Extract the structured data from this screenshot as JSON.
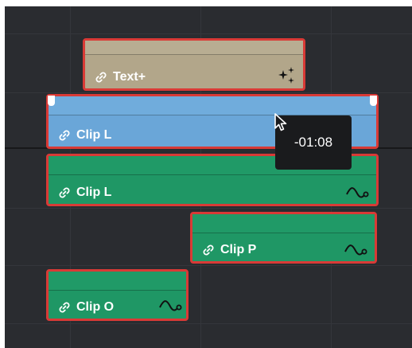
{
  "clips": [
    {
      "id": "text_plus",
      "label": "Text+",
      "color": "#b2a68a",
      "icon": "sparkles-icon"
    },
    {
      "id": "clip_l_top",
      "label": "Clip L",
      "color": "#6aa6d8",
      "icon": null
    },
    {
      "id": "clip_l_bottom",
      "label": "Clip L",
      "color": "#1f9765",
      "icon": "waveform-icon"
    },
    {
      "id": "clip_p",
      "label": "Clip P",
      "color": "#1f9765",
      "icon": "waveform-icon"
    },
    {
      "id": "clip_o",
      "label": "Clip O",
      "color": "#1f9765",
      "icon": "waveform-icon"
    }
  ],
  "tooltip": {
    "offset": "-01:08"
  },
  "colors": {
    "selection_border": "#d93a36",
    "timeline_bg": "#2a2c30",
    "tooltip_bg": "#1a1b1d"
  }
}
